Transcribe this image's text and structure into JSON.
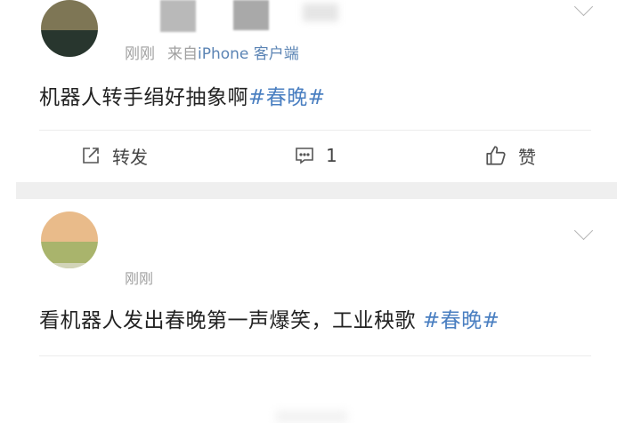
{
  "posts": [
    {
      "time": "刚刚",
      "source_prefix": "来自",
      "source_name": "iPhone 客户端",
      "text": "机器人转手绢好抽象啊",
      "topic": "#春晚#",
      "actions": {
        "repost": "转发",
        "comment_count": "1",
        "like": "赞"
      }
    },
    {
      "time": "刚刚",
      "text": "看机器人发出春晚第一声爆笑，工业秧歌 ",
      "topic": "#春晚#"
    }
  ],
  "icons": {
    "repost": "repost-icon",
    "comment": "comment-icon",
    "like": "thumbs-up-icon",
    "more": "chevron-down-icon"
  },
  "colors": {
    "topic": "#4a7fc1",
    "source": "#5b84b4",
    "meta": "#a0a0a0",
    "separator": "#efefef"
  }
}
